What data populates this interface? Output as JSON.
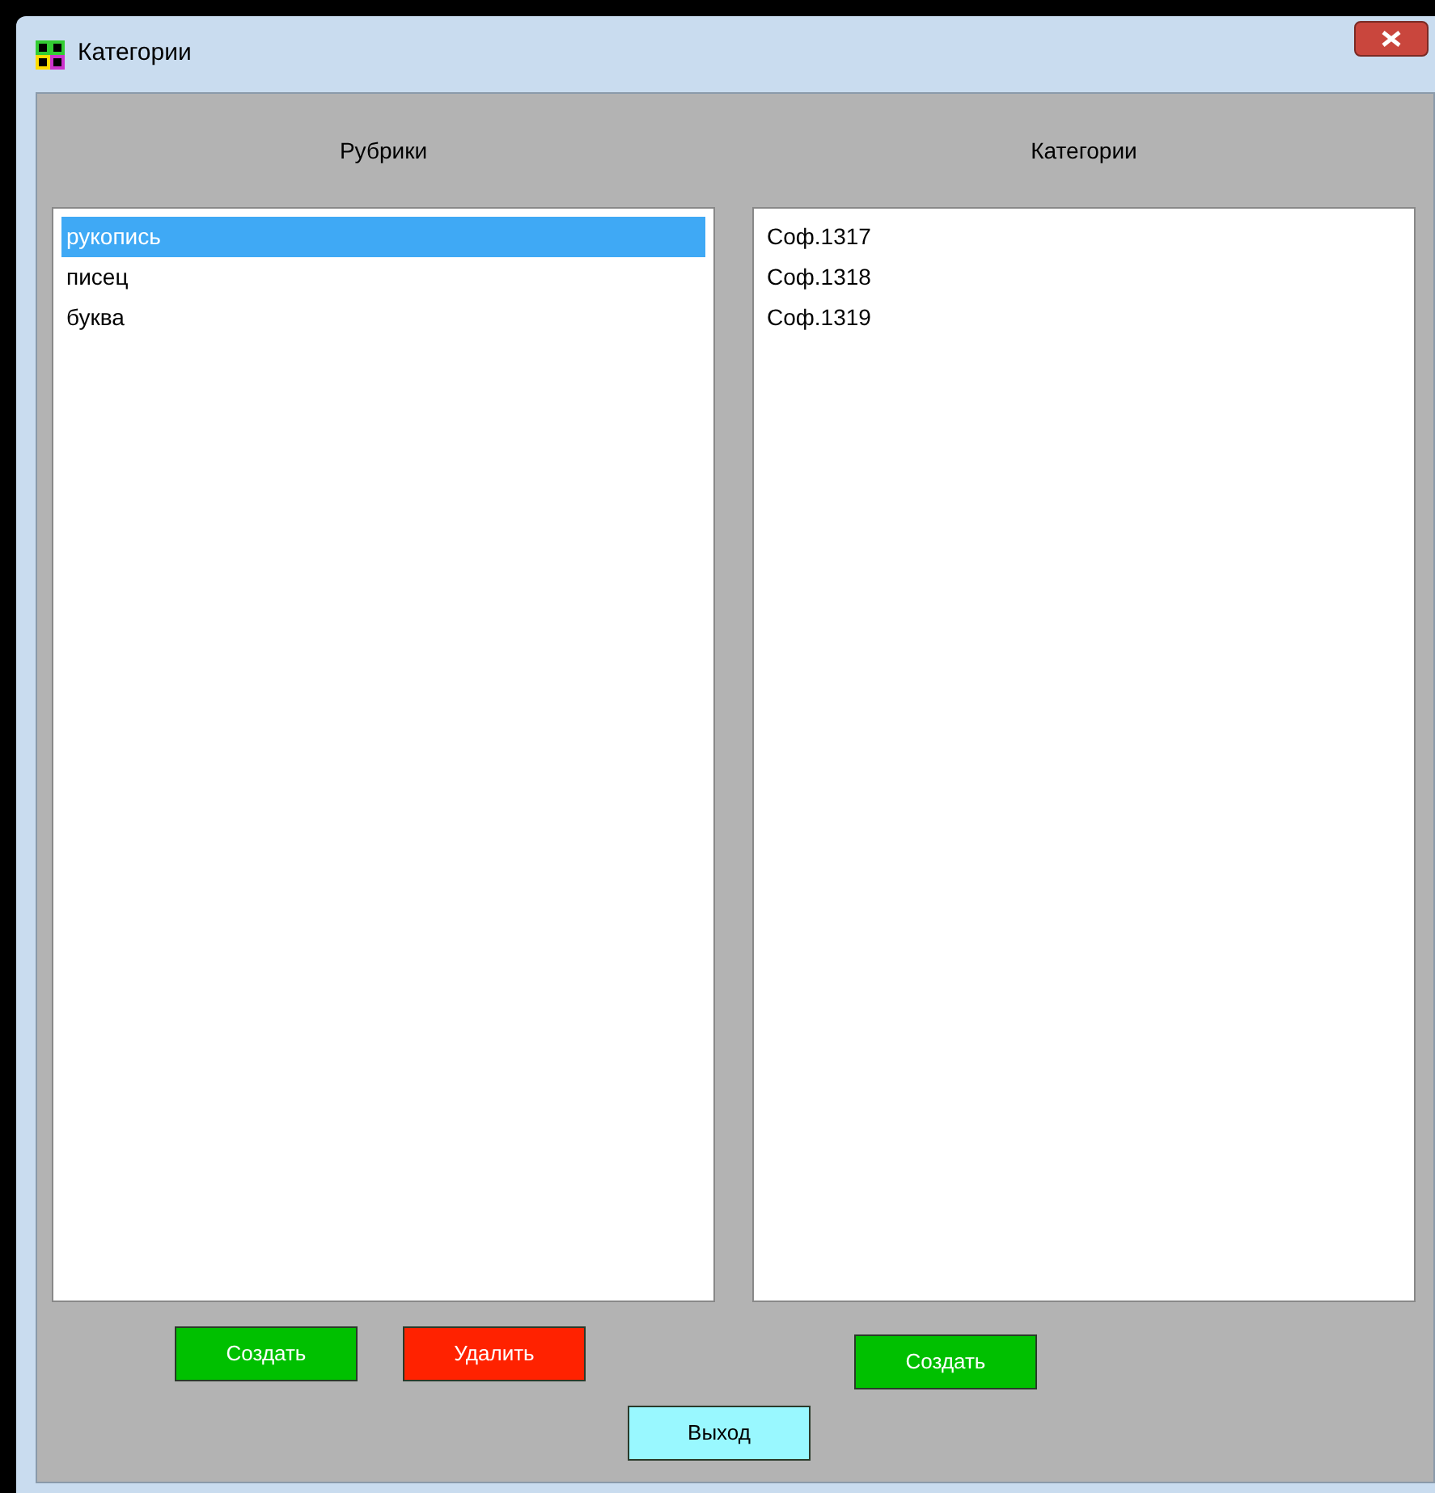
{
  "window": {
    "title": "Категории"
  },
  "rubrics": {
    "heading": "Рубрики",
    "items": [
      {
        "label": "рукопись",
        "selected": true
      },
      {
        "label": "писец",
        "selected": false
      },
      {
        "label": "буква",
        "selected": false
      }
    ],
    "buttons": [
      {
        "label": "Создать",
        "color": "#00c000"
      },
      {
        "label": "Удалить",
        "color": "#ff2200"
      }
    ]
  },
  "categories": {
    "heading": "Категории",
    "items": [
      {
        "label": "Соф.1317",
        "selected": false
      },
      {
        "label": "Соф.1318",
        "selected": false
      },
      {
        "label": "Соф.1319",
        "selected": false
      }
    ],
    "buttons": [
      {
        "label": "Создать",
        "color": "#00c000"
      }
    ]
  },
  "exit_button": {
    "label": "Выход",
    "color": "#99f8ff"
  }
}
